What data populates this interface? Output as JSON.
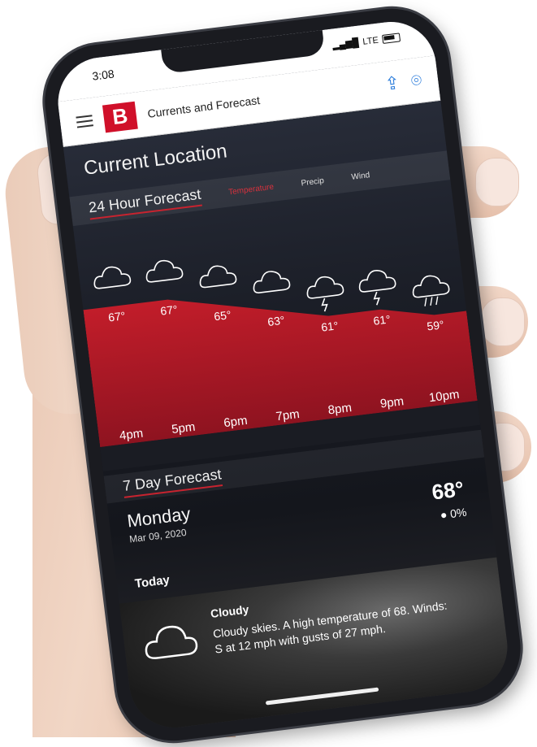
{
  "status": {
    "time": "3:08",
    "network": "LTE"
  },
  "header": {
    "title": "Currents and Forecast",
    "logo": "B"
  },
  "location_title": "Current Location",
  "forecast24": {
    "title": "24 Hour Forecast",
    "tabs": [
      "Temperature",
      "Precip",
      "Wind"
    ],
    "active_tab": "Temperature",
    "hours": [
      "4pm",
      "5pm",
      "6pm",
      "7pm",
      "8pm",
      "9pm",
      "10pm"
    ],
    "temps": [
      "67°",
      "67°",
      "65°",
      "63°",
      "61°",
      "61°",
      "59°"
    ],
    "icons": [
      "cloud-icon",
      "cloud-icon",
      "cloud-icon",
      "cloud-icon",
      "thunderstorm-icon",
      "thunderstorm-icon",
      "rain-icon"
    ],
    "accent": "#c21d2a"
  },
  "chart_data": {
    "type": "area",
    "categories": [
      "4pm",
      "5pm",
      "6pm",
      "7pm",
      "8pm",
      "9pm",
      "10pm"
    ],
    "values": [
      67,
      67,
      65,
      63,
      61,
      61,
      59
    ],
    "ylim": [
      55,
      70
    ]
  },
  "forecast7": {
    "title": "7 Day Forecast",
    "day": "Monday",
    "date": "Mar 09, 2020",
    "temp": "68°",
    "precip": "● 0%",
    "today_label": "Today",
    "condition": "Cloudy",
    "description": "Cloudy skies.  A high temperature of 68.  Winds: S at 12 mph with gusts of 27 mph."
  }
}
